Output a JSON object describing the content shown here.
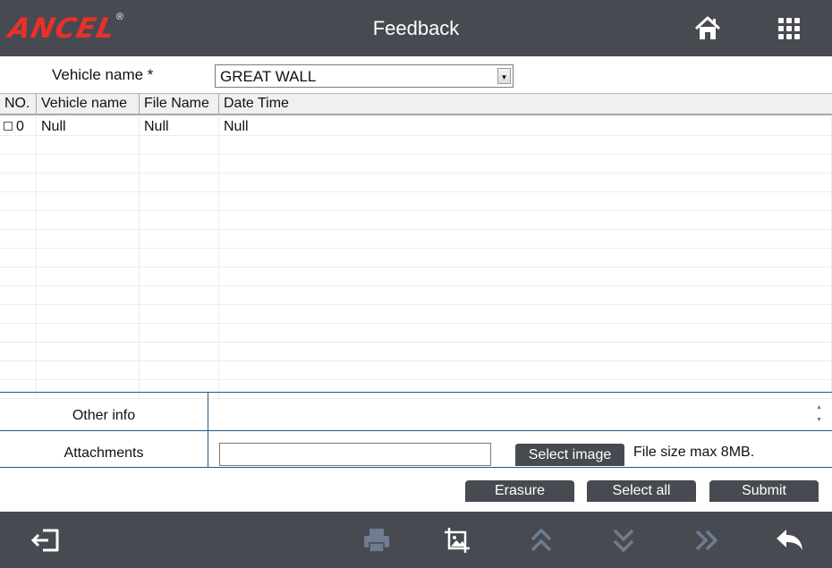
{
  "header": {
    "brand": "ANCEL",
    "registered_mark": "®",
    "title": "Feedback",
    "icons": [
      "home-icon",
      "apps-grid-icon"
    ]
  },
  "vehicle": {
    "label": "Vehicle name *",
    "selected": "GREAT WALL",
    "arrow": "▾"
  },
  "table": {
    "columns": [
      "NO.",
      "Vehicle name",
      "File Name",
      "Date Time"
    ],
    "rows": [
      {
        "no": "0",
        "vehicle_name": "Null",
        "file_name": "Null",
        "date_time": "Null"
      }
    ]
  },
  "form": {
    "other_info_label": "Other info",
    "other_info_value": "",
    "attachments_label": "Attachments",
    "attachment_value": "",
    "select_image_label": "Select image",
    "file_size_note": "File size max 8MB."
  },
  "actions": {
    "erasure": "Erasure",
    "select_all": "Select all",
    "submit": "Submit"
  },
  "footer": {
    "icons": [
      "exit-icon",
      "print-icon",
      "screenshot-icon",
      "page-up-icon",
      "page-down-icon",
      "fast-forward-icon",
      "back-icon"
    ]
  },
  "colors": {
    "bar": "#474a50",
    "brand_red": "#e8312b",
    "divider_blue": "#1e5a84",
    "disabled_icon": "#6e7d92"
  }
}
